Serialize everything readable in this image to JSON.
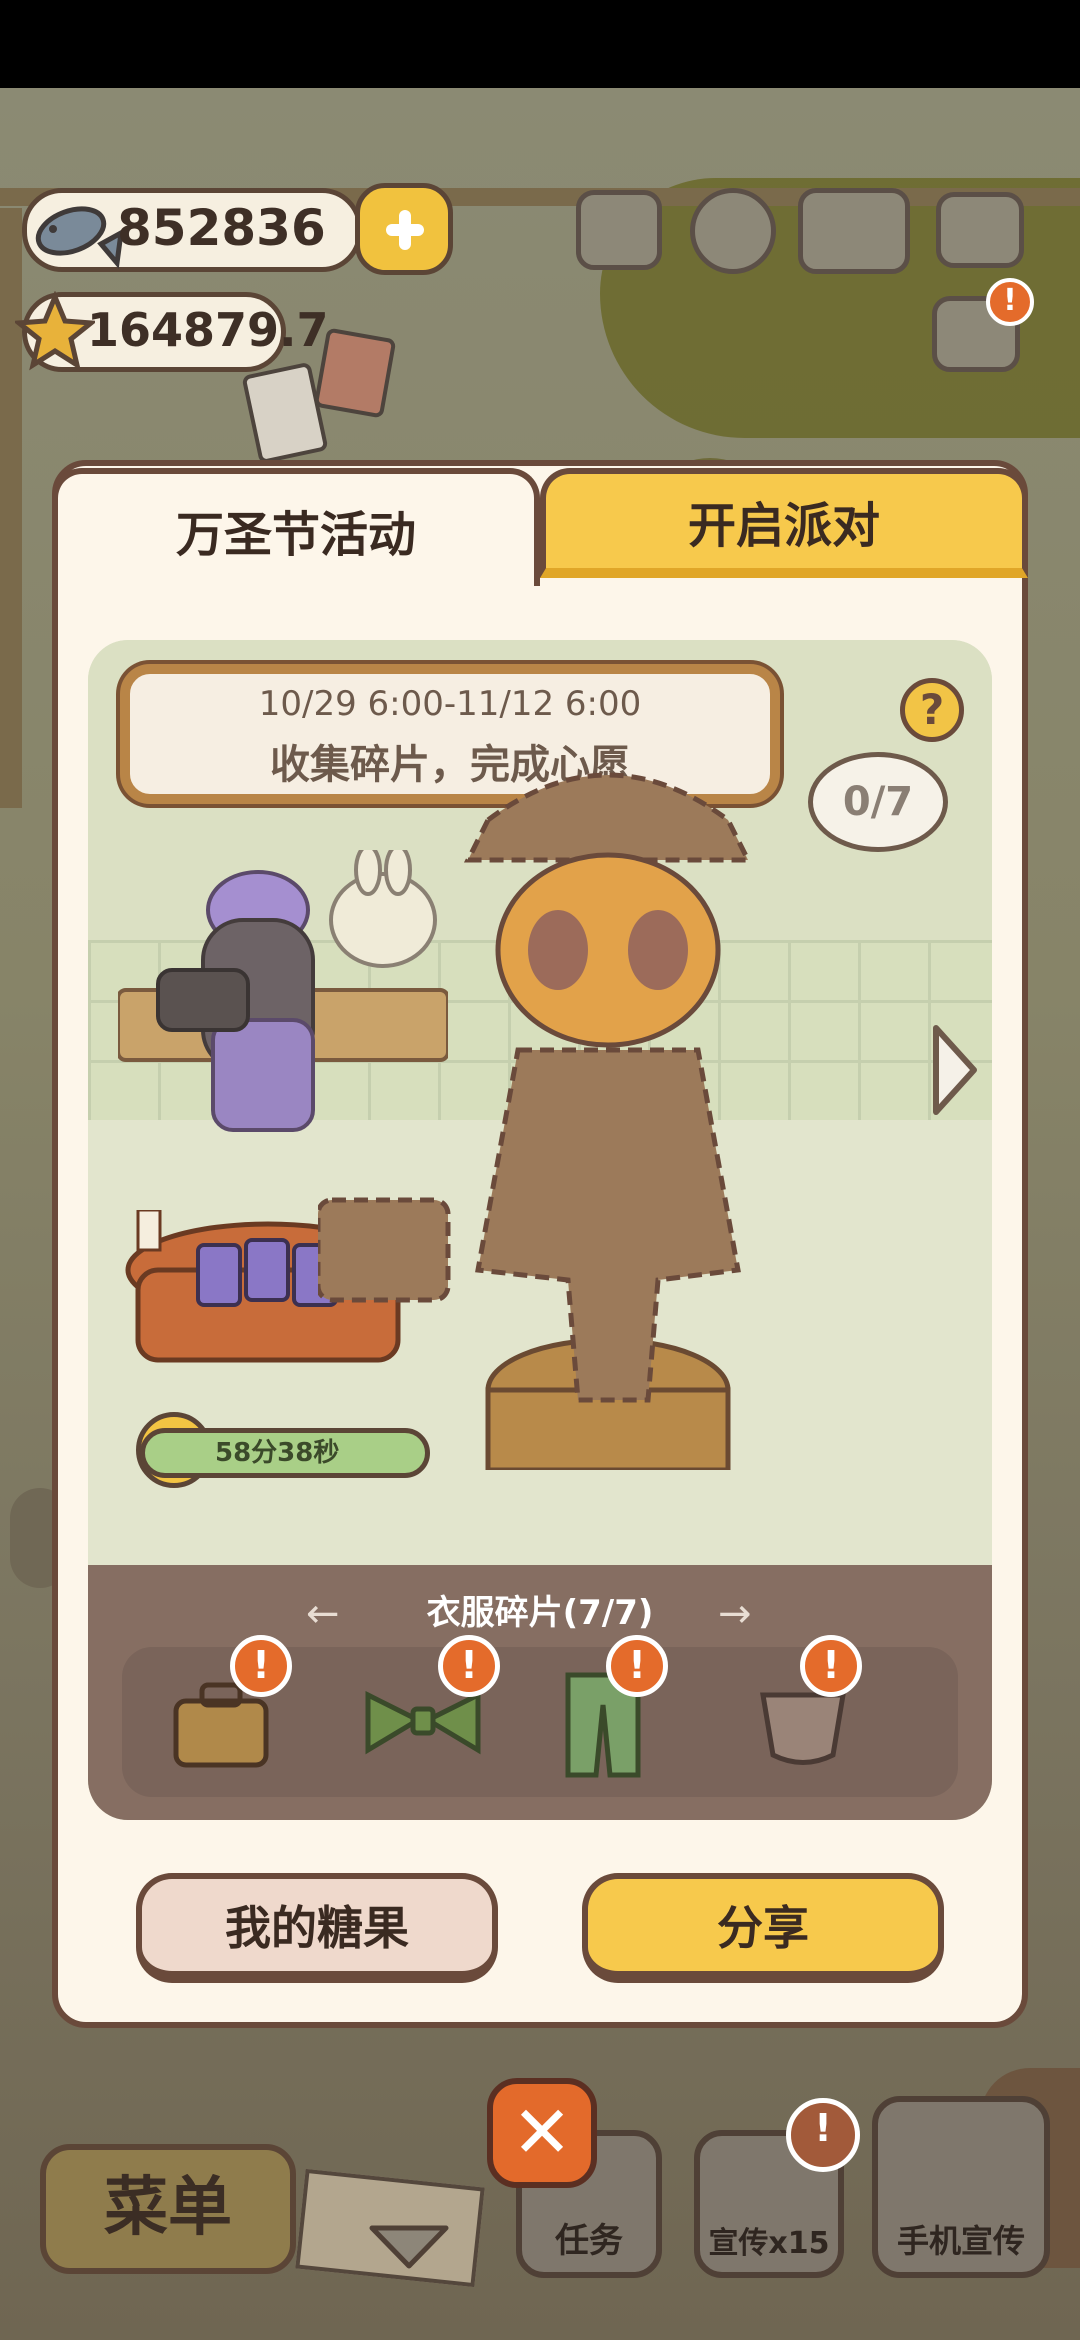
{
  "hud": {
    "fish_count": "852836",
    "star_count": "164879.7"
  },
  "dialog": {
    "tabs": [
      {
        "label": "万圣节活动",
        "active": true
      },
      {
        "label": "开启派对",
        "active": false
      }
    ],
    "event": {
      "date_range": "10/29 6:00-11/12 6:00",
      "description": "收集碎片，完成心愿",
      "progress_text": "0/7",
      "timer_text": "58分38秒"
    },
    "parts": {
      "title": "衣服碎片(7/7)",
      "items": [
        {
          "icon": "suitcase-icon",
          "alert": "!"
        },
        {
          "icon": "bowtie-icon",
          "alert": "!"
        },
        {
          "icon": "pants-icon",
          "alert": "!"
        },
        {
          "icon": "bag-icon",
          "alert": "!"
        }
      ]
    },
    "buttons": {
      "my_candy": "我的糖果",
      "share": "分享"
    }
  },
  "bottom_bar": {
    "menu": "菜单",
    "tasks": "任务",
    "promote": "宣传x15",
    "phone_promote": "手机宣传",
    "promote_alert": "!"
  },
  "colors": {
    "accent_yellow": "#f7c94c",
    "close_orange": "#e36a2b",
    "dialog_bg": "#fdf6ea",
    "border_brown": "#6a4a3b"
  }
}
